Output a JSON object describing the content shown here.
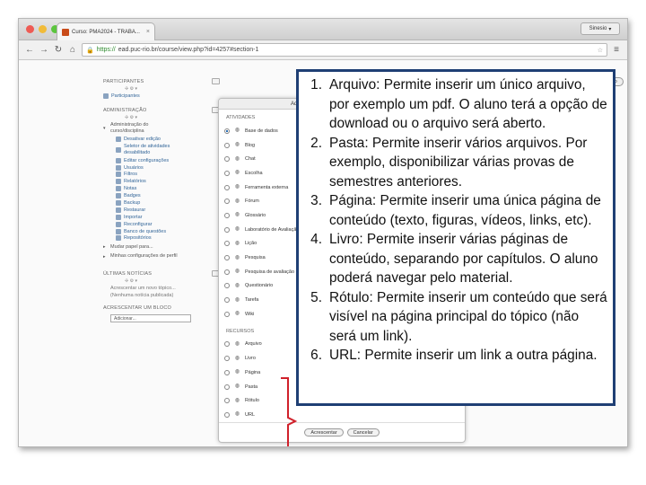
{
  "browser": {
    "tab_title": "Curso: PMA2024 - TRABA...",
    "user": "Sinesio",
    "url_scheme": "https://",
    "url_rest": "ead.puc-rio.br/course/view.php?id=4257#section-1"
  },
  "page": {
    "edit_button": "Desativar edição"
  },
  "sidebar": {
    "participants_title": "PARTICIPANTES",
    "participants_item": "Participantes",
    "admin_title": "ADMINISTRAÇÃO",
    "admin_group": "Administração do curso/disciplina",
    "admin_items": [
      "Desativar edição",
      "Editar configurações",
      "Usuários",
      "Filtros",
      "Relatórios",
      "Notas",
      "Badges",
      "Backup",
      "Restaurar",
      "Importar",
      "Reconfigurar",
      "Banco de questões",
      "Repositórios"
    ],
    "selector_item": "Seletor de atividades desabilitado",
    "switch_role": "Mudar papel para...",
    "profile_settings": "Minhas configurações de perfil",
    "news_title": "ÚLTIMAS NOTÍCIAS",
    "news_add": "Acrescentar um novo tópico...",
    "news_none": "(Nenhuma notícia publicada)",
    "add_block_title": "ACRESCENTAR UM BLOCO",
    "add_block_select": "Adicionar..."
  },
  "chooser": {
    "header": "Adicionar uma atividade ou recurso",
    "activities_title": "ATIVIDADES",
    "activities": [
      "Base de dados",
      "Blog",
      "Chat",
      "Escolha",
      "Ferramenta externa",
      "Fórum",
      "Glossário",
      "Laboratório de Avaliação",
      "Lição",
      "Pesquisa",
      "Pesquisa de avaliação",
      "Questionário",
      "Tarefa",
      "Wiki"
    ],
    "resources_title": "RECURSOS",
    "resources": [
      "Arquivo",
      "Livro",
      "Página",
      "Pasta",
      "Rótulo",
      "URL"
    ],
    "add_button": "Acrescentar",
    "cancel_button": "Cancelar"
  },
  "callout": {
    "items": [
      {
        "num": "1.",
        "text": "Arquivo: Permite inserir um único arquivo, por exemplo um pdf. O aluno terá a opção de download ou o arquivo será aberto."
      },
      {
        "num": "2.",
        "text": "Pasta: Permite inserir vários arquivos. Por exemplo, disponibilizar várias provas de semestres anteriores."
      },
      {
        "num": "3.",
        "text": "Página: Permite inserir uma única página de conteúdo (texto, figuras, vídeos, links, etc)."
      },
      {
        "num": "4.",
        "text": "Livro: Permite inserir várias páginas de conteúdo, separando por capítulos. O aluno poderá navegar pelo material."
      },
      {
        "num": "5.",
        "text": "Rótulo: Permite inserir um conteúdo que será visível na página principal do tópico (não será um link)."
      },
      {
        "num": "6.",
        "text": "URL: Permite inserir um link a outra página."
      }
    ]
  },
  "colors": {
    "callout_border": "#1f3f74",
    "bracket": "#d0202a",
    "link": "#336699"
  }
}
